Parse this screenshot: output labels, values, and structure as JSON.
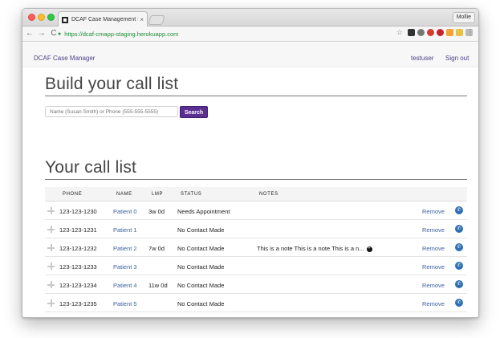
{
  "browser": {
    "tab_title": "DCAF Case Management Syst",
    "tab_close": "×",
    "profile_name": "Mollie",
    "url": "https://dcaf-cmapp-staging.herokuapp.com",
    "nav_back": "←",
    "nav_forward": "→",
    "nav_reload": "C",
    "star": "☆",
    "menu": "⋮"
  },
  "navbar": {
    "brand": "DCAF Case Manager",
    "user": "testuser",
    "signout": "Sign out"
  },
  "build": {
    "heading": "Build your call list",
    "search_placeholder": "Name (Susan Smith) or Phone (555-555-5555)",
    "search_button": "Search"
  },
  "call_list": {
    "heading": "Your call list",
    "columns": {
      "phone": "PHONE",
      "name": "NAME",
      "lmp": "LMP",
      "status": "STATUS",
      "notes": "NOTES"
    },
    "rows": [
      {
        "phone": "123-123-1230",
        "name": "Patient 0",
        "lmp": "3w 0d",
        "status": "Needs Appointment",
        "notes": "",
        "remove": "Remove"
      },
      {
        "phone": "123-123-1231",
        "name": "Patient 1",
        "lmp": "",
        "status": "No Contact Made",
        "notes": "",
        "remove": "Remove"
      },
      {
        "phone": "123-123-1232",
        "name": "Patient 2",
        "lmp": "7w 0d",
        "status": "No Contact Made",
        "notes": "This is a note This is a note This is a n...",
        "remove": "Remove"
      },
      {
        "phone": "123-123-1233",
        "name": "Patient 3",
        "lmp": "",
        "status": "No Contact Made",
        "notes": "",
        "remove": "Remove"
      },
      {
        "phone": "123-123-1234",
        "name": "Patient 4",
        "lmp": "11w 0d",
        "status": "No Contact Made",
        "notes": "",
        "remove": "Remove"
      },
      {
        "phone": "123-123-1235",
        "name": "Patient 5",
        "lmp": "",
        "status": "No Contact Made",
        "notes": "",
        "remove": "Remove"
      }
    ]
  },
  "icons": {
    "drag": "drag-handle-icon",
    "phone": "phone-icon",
    "expand_note": "plus-circle-icon"
  },
  "colors": {
    "accent": "#5b2e91",
    "link": "#3b62a3",
    "phone_icon": "#2d6fb6"
  }
}
